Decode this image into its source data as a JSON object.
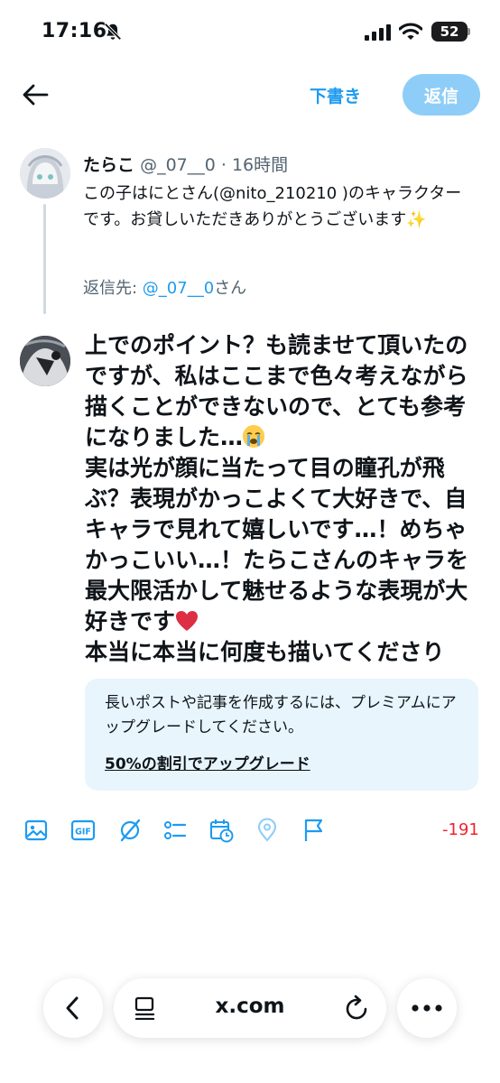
{
  "status_bar": {
    "time": "17:16",
    "battery": "52"
  },
  "header": {
    "drafts_label": "下書き",
    "reply_label": "返信"
  },
  "original_tweet": {
    "name": "たらこ",
    "handle": "@_07__0",
    "separator": "·",
    "time": "16時間",
    "text": "この子はにとさん(@nito_210210 )のキャラクターです。お貸しいただきありがとうございます✨",
    "replying_prefix": "返信先: ",
    "replying_user": "@_07__0",
    "replying_suffix": "さん"
  },
  "compose": {
    "text_1": "上でのポイント？も読ませて頂いたのですが、私はここまで色々考えながら描くことができないので、とても参考になりました…",
    "text_2": "\n実は光が顔に当たって目の瞳孔が飛ぶ？表現がかっこよくて大好きで、自キャラで見れて嬉しいです…！めちゃかっこいい…！たらこさんのキャラを最大限活かして魅せるような表現が大好きです",
    "text_3": "\n本当に本当に何度も描いてくださり"
  },
  "premium": {
    "text": "長いポストや記事を作成するには、プレミアムにアップグレードしてください。",
    "link": "50%の割引でアップグレード"
  },
  "toolbar": {
    "icons": [
      "image-icon",
      "gif-icon",
      "grok-icon",
      "poll-icon",
      "schedule-icon",
      "location-icon",
      "flag-icon"
    ],
    "char_count": "-191"
  },
  "browser": {
    "url": "x.com"
  },
  "colors": {
    "accent": "#1d9bf0",
    "reply_button": "#8ecdf8",
    "premium_bg": "#e8f5fd",
    "counter": "#f4212e"
  }
}
